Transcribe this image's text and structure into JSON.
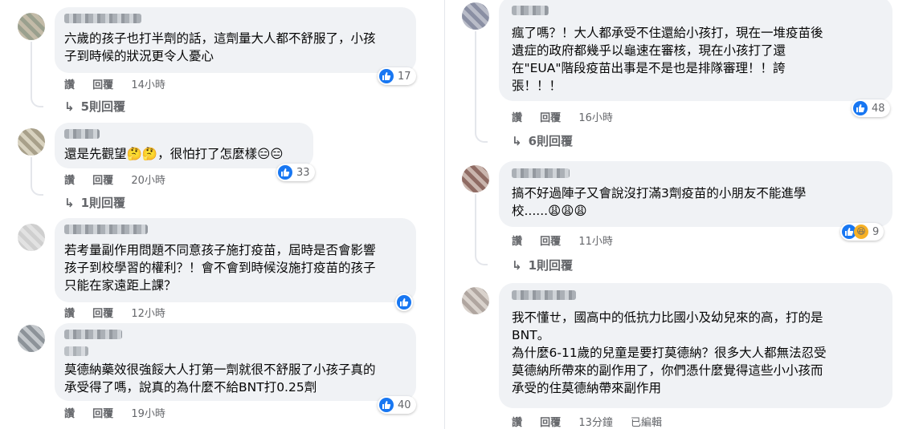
{
  "left_comments": [
    {
      "text_lines": [
        "六歲的孩子也打半劑的話，這劑量大人都不舒服了，小孩",
        "子到時候的狀況更令人憂心"
      ],
      "actions": {
        "like": "讚",
        "reply": "回覆",
        "time": "14小時"
      },
      "reactions": {
        "count": "17"
      },
      "replies": "5則回覆"
    },
    {
      "text_lines": [
        "還是先觀望🤔🤔，很怕打了怎麼樣😑😑"
      ],
      "actions": {
        "like": "讚",
        "reply": "回覆",
        "time": "20小時"
      },
      "reactions": {
        "count": "33"
      },
      "replies": "1則回覆"
    },
    {
      "text_lines": [
        "若考量副作用問題不同意孩子施打疫苗，屆時是否會影響",
        "孩子到校學習的權利？！會不會到時候沒施打疫苗的孩子",
        "只能在家遠距上課？"
      ],
      "actions": {
        "like": "讚",
        "reply": "回覆",
        "time": "12小時"
      },
      "reactions": {
        "count": ""
      }
    },
    {
      "text_lines": [
        "莫德納藥效很強餒大人打第一劑就很不舒服了小孩子真的",
        "承受得了嗎，說真的為什麼不給BNT打0.25劑"
      ],
      "actions": {
        "like": "讚",
        "reply": "回覆",
        "time": "19小時"
      },
      "reactions": {
        "count": "40"
      }
    }
  ],
  "right_comments": [
    {
      "text_lines": [
        "瘋了嗎？！大人都承受不住還給小孩打，現在一堆疫苗後",
        "遺症的政府都幾乎以龜速在審核，現在小孩打了還",
        "在\"EUA\"階段疫苗出事是不是也是排隊審理！！誇",
        "張！！！"
      ],
      "actions": {
        "like": "讚",
        "reply": "回覆",
        "time": "16小時"
      },
      "reactions": {
        "count": "48"
      },
      "replies": "6則回覆"
    },
    {
      "text_lines": [
        "搞不好過陣子又會說沒打滿3劑疫苗的小朋友不能進學",
        "校......😩😩😩"
      ],
      "actions": {
        "like": "讚",
        "reply": "回覆",
        "time": "11小時"
      },
      "reactions": {
        "count": "9"
      },
      "replies": "1則回覆"
    },
    {
      "text_lines": [
        "我不懂ㄝ，國高中的低抗力比國小及幼兒來的高，打的是",
        "BNT。",
        "為什麼6-11歲的兒童是要打莫德納？很多大人都無法忍受",
        "莫德納所帶來的副作用了，你們憑什麼覺得這些小小孩而",
        "承受的住莫德納帶來副作用"
      ],
      "actions": {
        "like": "讚",
        "reply": "回覆",
        "time": "13分鐘",
        "edited": "已編輯"
      }
    }
  ],
  "colors": {
    "bubble": "#f0f2f5",
    "like": "#1877f2",
    "muted": "#65676b"
  }
}
